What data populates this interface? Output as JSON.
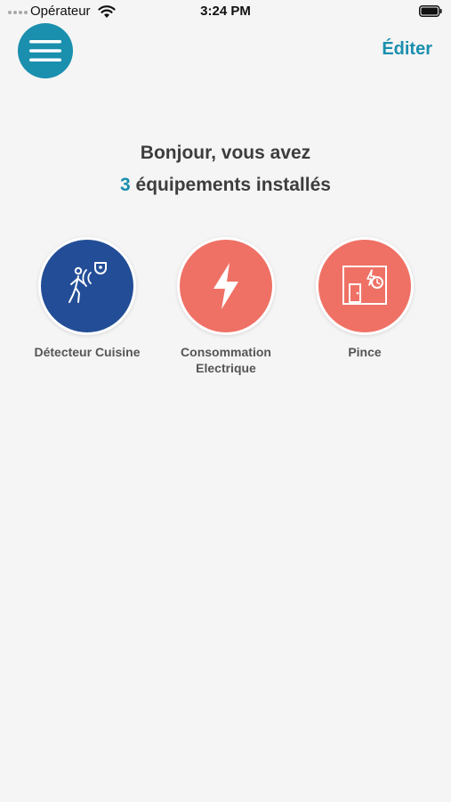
{
  "status_bar": {
    "carrier": "Opérateur",
    "time": "3:24 PM"
  },
  "header": {
    "edit_label": "Éditer"
  },
  "greeting": {
    "line1": "Bonjour, vous avez",
    "count": "3",
    "line2_suffix": " équipements installés"
  },
  "colors": {
    "accent": "#1a8fae",
    "detector": "#234e97",
    "coral": "#ef7165"
  },
  "devices": [
    {
      "label": "Détecteur Cuisine",
      "icon": "motion-detector-icon"
    },
    {
      "label": "Consommation\nElectrique",
      "icon": "lightning-icon"
    },
    {
      "label": "Pince",
      "icon": "electrical-panel-icon"
    }
  ]
}
